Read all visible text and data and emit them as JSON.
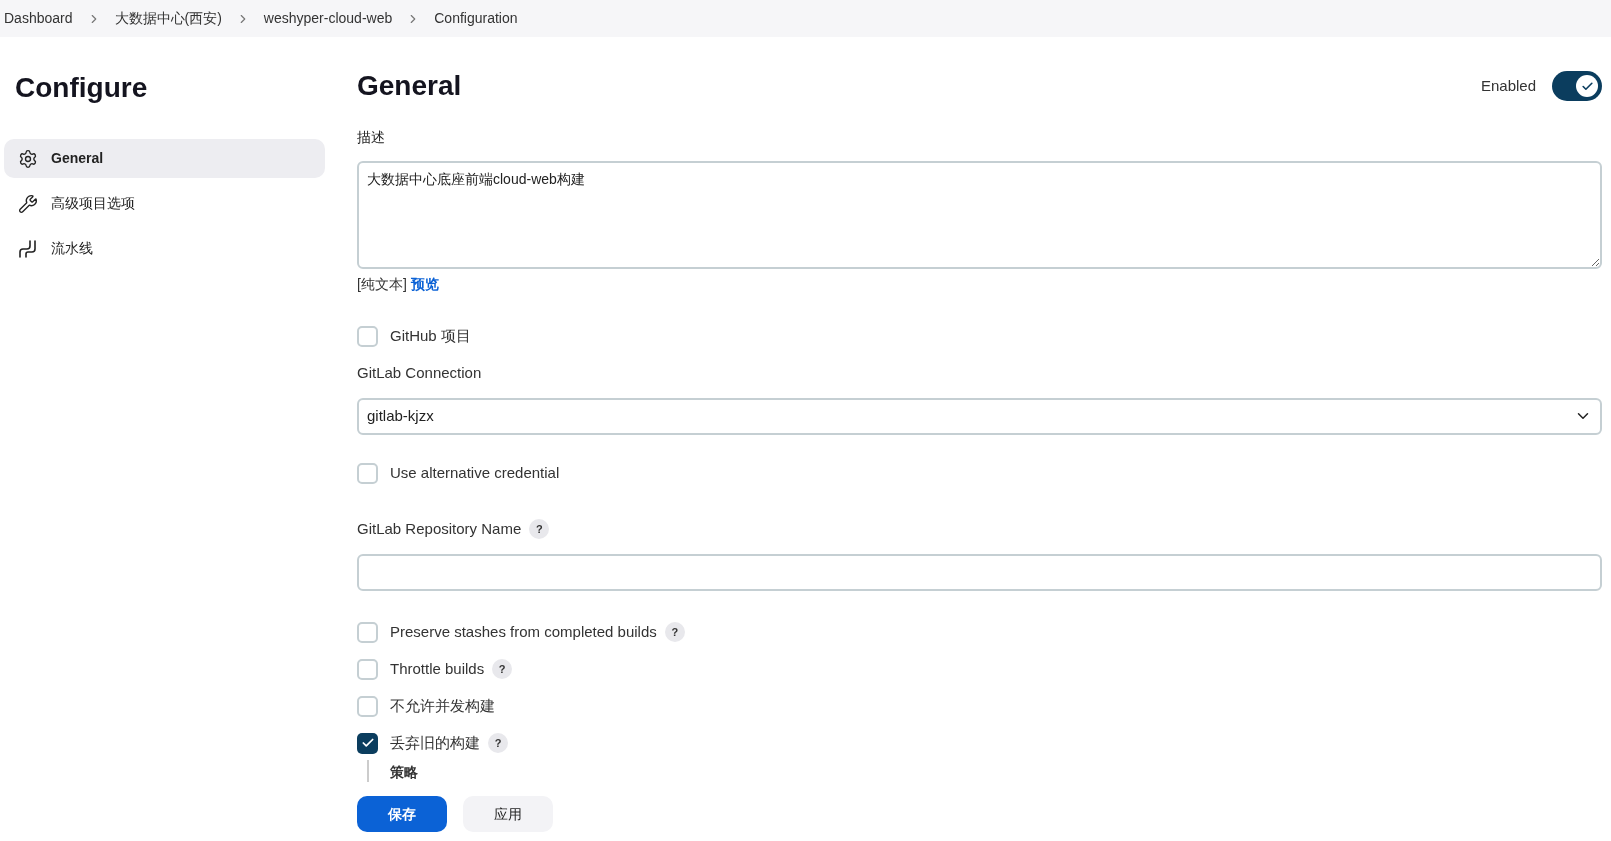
{
  "breadcrumbs": [
    "Dashboard",
    "大数据中心(西安)",
    "weshyper-cloud-web",
    "Configuration"
  ],
  "sidebar": {
    "title": "Configure",
    "items": [
      {
        "label": "General",
        "selected": true
      },
      {
        "label": "高级项目选项",
        "selected": false
      },
      {
        "label": "流水线",
        "selected": false
      }
    ]
  },
  "section": {
    "title": "General",
    "enabled_label": "Enabled",
    "enabled": true
  },
  "fields": [
    {
      "kind": "textarea",
      "label": "描述",
      "value": "大数据中心底座前端cloud-web构建",
      "format": "[纯文本]",
      "preview": "预览"
    },
    {
      "kind": "checkbox",
      "label": "GitHub 项目",
      "checked": false
    },
    {
      "kind": "select",
      "label": "GitLab Connection",
      "value": "gitlab-kjzx"
    },
    {
      "kind": "checkbox",
      "label": "Use alternative credential",
      "checked": false
    },
    {
      "kind": "input",
      "label": "GitLab Repository Name",
      "help": "?"
    },
    {
      "kind": "checkbox",
      "label": "Preserve stashes from completed builds",
      "checked": false,
      "help": "?"
    },
    {
      "kind": "checkbox",
      "label": "Throttle builds",
      "checked": false,
      "help": "?"
    },
    {
      "kind": "checkbox",
      "label": "不允许并发构建",
      "checked": false
    },
    {
      "kind": "checkbox",
      "label": "丢弃旧的构建",
      "checked": true,
      "help": "?",
      "sub_label": "策略"
    }
  ],
  "footer": {
    "save": "保存",
    "apply": "应用"
  }
}
